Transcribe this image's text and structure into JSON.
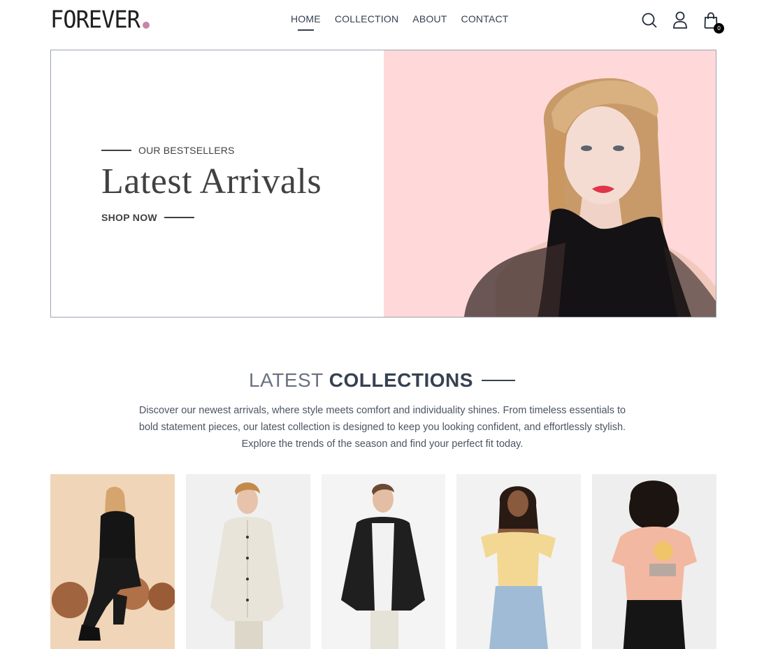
{
  "brand": {
    "name": "FOREVER",
    "dot_color": "#c586a5"
  },
  "nav": {
    "links": [
      {
        "label": "HOME",
        "active": true
      },
      {
        "label": "COLLECTION",
        "active": false
      },
      {
        "label": "ABOUT",
        "active": false
      },
      {
        "label": "CONTACT",
        "active": false
      }
    ],
    "icons": [
      "search-icon",
      "profile-icon",
      "cart-icon"
    ],
    "cart_count": "0"
  },
  "hero": {
    "tag": "OUR BESTSELLERS",
    "title": "Latest Arrivals",
    "cta": "SHOP NOW",
    "image_bg": "#ffd9d9"
  },
  "section": {
    "title_light": "LATEST",
    "title_bold": "COLLECTIONS",
    "description": "Discover our newest arrivals, where style meets comfort and individuality shines. From timeless essentials to bold statement pieces, our latest collection is designed to keep you looking confident, and effortlessly stylish. Explore the trends of the season and find your perfect fit today."
  },
  "products": [
    {
      "bg": "#f0d5b8"
    },
    {
      "bg": "#f0f0f0"
    },
    {
      "bg": "#f4f4f4"
    },
    {
      "bg": "#f2f2f2"
    },
    {
      "bg": "#eeeeee"
    }
  ]
}
